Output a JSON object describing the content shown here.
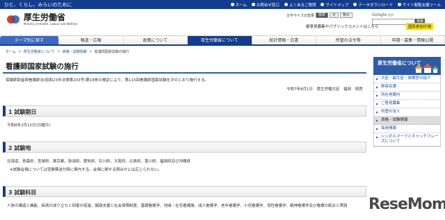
{
  "topbar": {
    "tagline": "ひと、くらし、みらいのために",
    "links": [
      "ホーム",
      "お問合せ窓口",
      "よくあるご質問",
      "サイトマップ",
      "国民参加の場",
      "サイト閲覧支援ツール"
    ],
    "links_extra": "データダウンロード"
  },
  "header": {
    "logo_jp": "厚生労働省",
    "logo_en": "Ministry of Health, Labour and Welfare",
    "fontsize_label": "文字サイズの変更",
    "fontsize_buttons": [
      "標準",
      "大",
      "特大"
    ],
    "search_placeholder": "",
    "search_brand": "Google",
    "search_hint": "提供",
    "search_button": "検索",
    "banner": "御意見募集やパブリックコメントはこちら",
    "banner_button": "国民参加の場"
  },
  "gnav": [
    "テーマ別に探す",
    "報道・広報",
    "政策について",
    "厚生労働省について",
    "統計情報・白書",
    "所管の法令等",
    "申請・募集・情報公開"
  ],
  "breadcrumb": [
    "ホーム",
    "厚生労働省について",
    "資格・試験情報",
    "看護師国家試験の施行"
  ],
  "page": {
    "title": "看護師国家試験の施行",
    "intro": "保健師助産師看護師法(昭和23年法律第203号)第18条の規定により、第115回看護師国家試験を次のとおり施行する。",
    "signature": "令和7年8月1日　厚生労働大臣　福岡　資麿",
    "sections": [
      {
        "heading": "1 試験期日",
        "body": "令和8年2月15日(日曜日)"
      },
      {
        "heading": "2 試験地",
        "body": "北海道、青森県、宮城県、東京都、新潟県、愛知県、石川県、大阪府、広島県、香川県、福岡県及び沖縄県",
        "note": "※試験会場については受験票送付時に案内する。会場に関する問合せには応じられない。"
      },
      {
        "heading": "3 試験科目",
        "body": "人体の構造と機能、疾病の成り立ちと回復の促進、健康支援と社会保障制度、基礎看護学、地域・在宅看護論、成人看護学、老年看護学、小児看護学、母性看護学、精神看護学及び看護の統合と実践"
      }
    ]
  },
  "sidebar": {
    "heading": "厚生労働省について",
    "items": [
      "大臣・副大臣・政務官の紹介",
      "幹部名簿",
      "所在地案内",
      "ご意見募集",
      "所管の法人",
      "資格・試験情報",
      "採用情報",
      "シンボルマークとキャッチフレーズについて"
    ],
    "current_index": 5
  },
  "watermark": {
    "main": "ReseMom",
    "dot": "."
  },
  "colors": {
    "brand": "#143c8c",
    "accent": "#2c5ca8",
    "banner": "#f6e000"
  }
}
